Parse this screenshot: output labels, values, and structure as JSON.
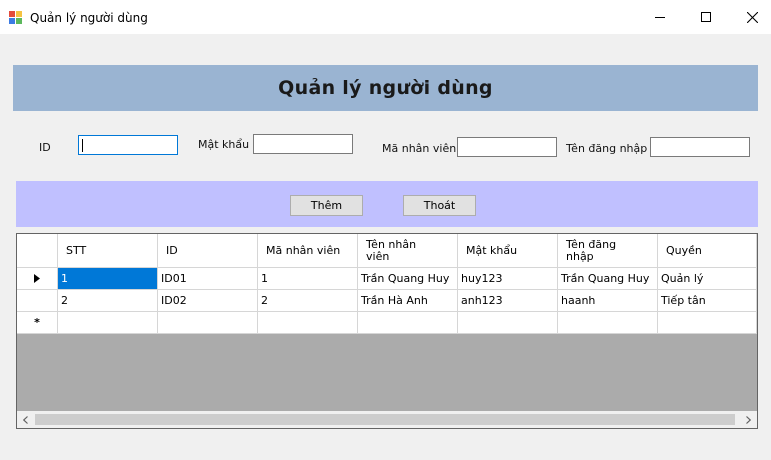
{
  "window": {
    "title": "Quản lý người dùng",
    "icon": "form-app-icon",
    "controls": [
      "minimize-icon",
      "maximize-icon",
      "close-icon"
    ]
  },
  "header": {
    "title": "Quản lý người dùng",
    "background": "#9ab4d2"
  },
  "form": {
    "id_label": "ID",
    "id_value": "",
    "password_label": "Mật khẩu",
    "password_value": "",
    "employee_code_label": "Mã nhân viên",
    "employee_code_value": "",
    "username_label": "Tên đăng nhập",
    "username_value": ""
  },
  "actions": {
    "background": "#c0c0ff",
    "add_label": "Thêm",
    "exit_label": "Thoát"
  },
  "table": {
    "columns": [
      {
        "line1": "STT",
        "line2": ""
      },
      {
        "line1": "ID",
        "line2": ""
      },
      {
        "line1": "Mã nhân viên",
        "line2": ""
      },
      {
        "line1": "Tên nhân",
        "line2": "viên"
      },
      {
        "line1": "Mật khẩu",
        "line2": ""
      },
      {
        "line1": "Tên đăng",
        "line2": "nhập"
      },
      {
        "line1": "Quyền",
        "line2": ""
      }
    ],
    "rows": [
      [
        "1",
        "ID01",
        "1",
        "Trần Quang Huy",
        "huy123",
        "Trần Quang Huy",
        "Quản lý"
      ],
      [
        "2",
        "ID02",
        "2",
        "Trần Hà Anh",
        "anh123",
        "haanh",
        "Tiếp tân"
      ]
    ],
    "current_row_marker": "current-row-arrow-icon",
    "new_row_marker": "*",
    "selected_cell_color": "#0078d7"
  },
  "scrollbar": {
    "left_arrow": "scroll-left-icon",
    "right_arrow": "scroll-right-icon"
  }
}
